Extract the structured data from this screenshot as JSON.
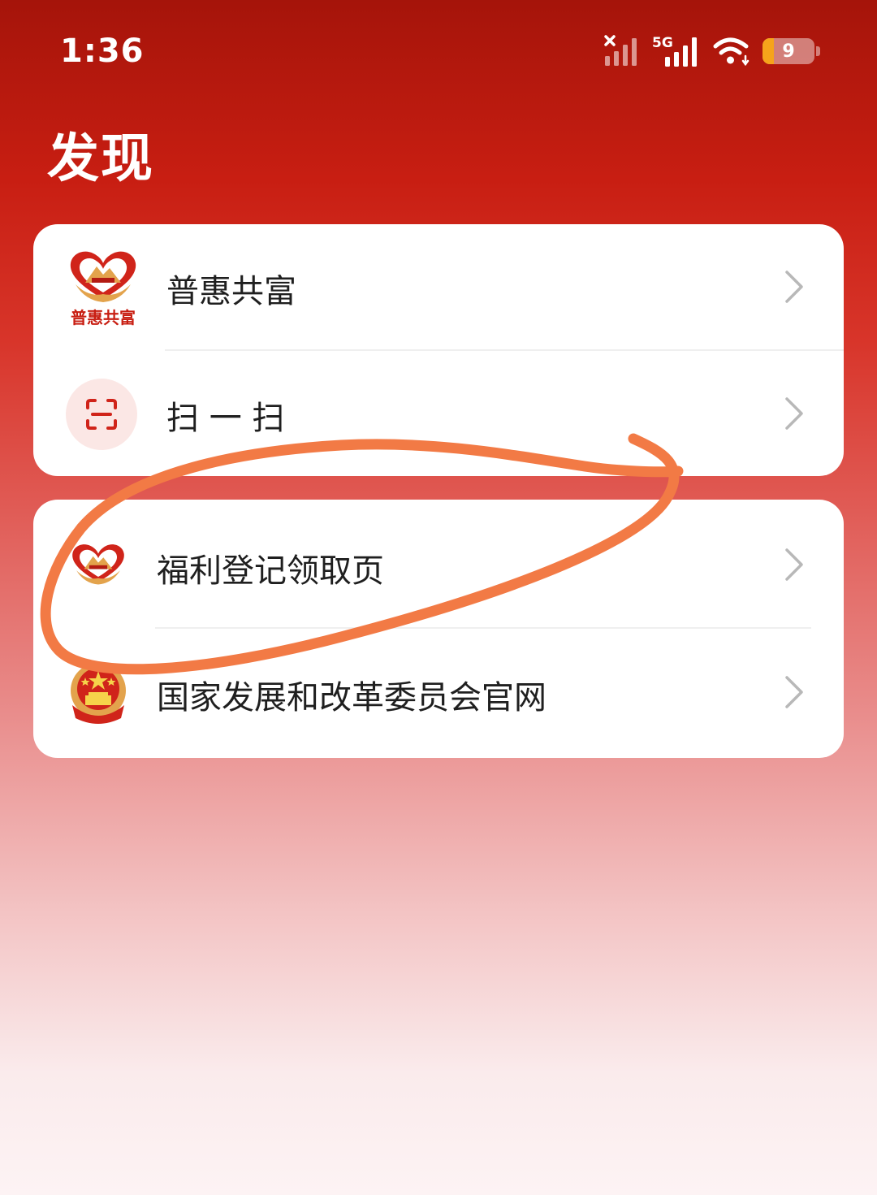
{
  "status_bar": {
    "time": "1:36",
    "battery_level": "9",
    "network_type": "5G",
    "battery_fraction": 0.09
  },
  "page": {
    "title": "发现"
  },
  "menu": {
    "group1": [
      {
        "label": "普惠共富",
        "icon": "heart-logo-icon",
        "logo_text": "普惠共富"
      },
      {
        "label": "扫 一 扫",
        "icon": "scan-icon"
      }
    ],
    "group2": [
      {
        "label": "福利登记领取页",
        "icon": "heart-logo-icon"
      },
      {
        "label": "国家发展和改革委员会官网",
        "icon": "national-emblem-icon"
      }
    ]
  },
  "colors": {
    "header_red": "#c81e12",
    "logo_red": "#d0241a",
    "logo_gold": "#e3a34c",
    "annotation_orange": "#f27a45",
    "battery_orange": "#f6a31b"
  }
}
